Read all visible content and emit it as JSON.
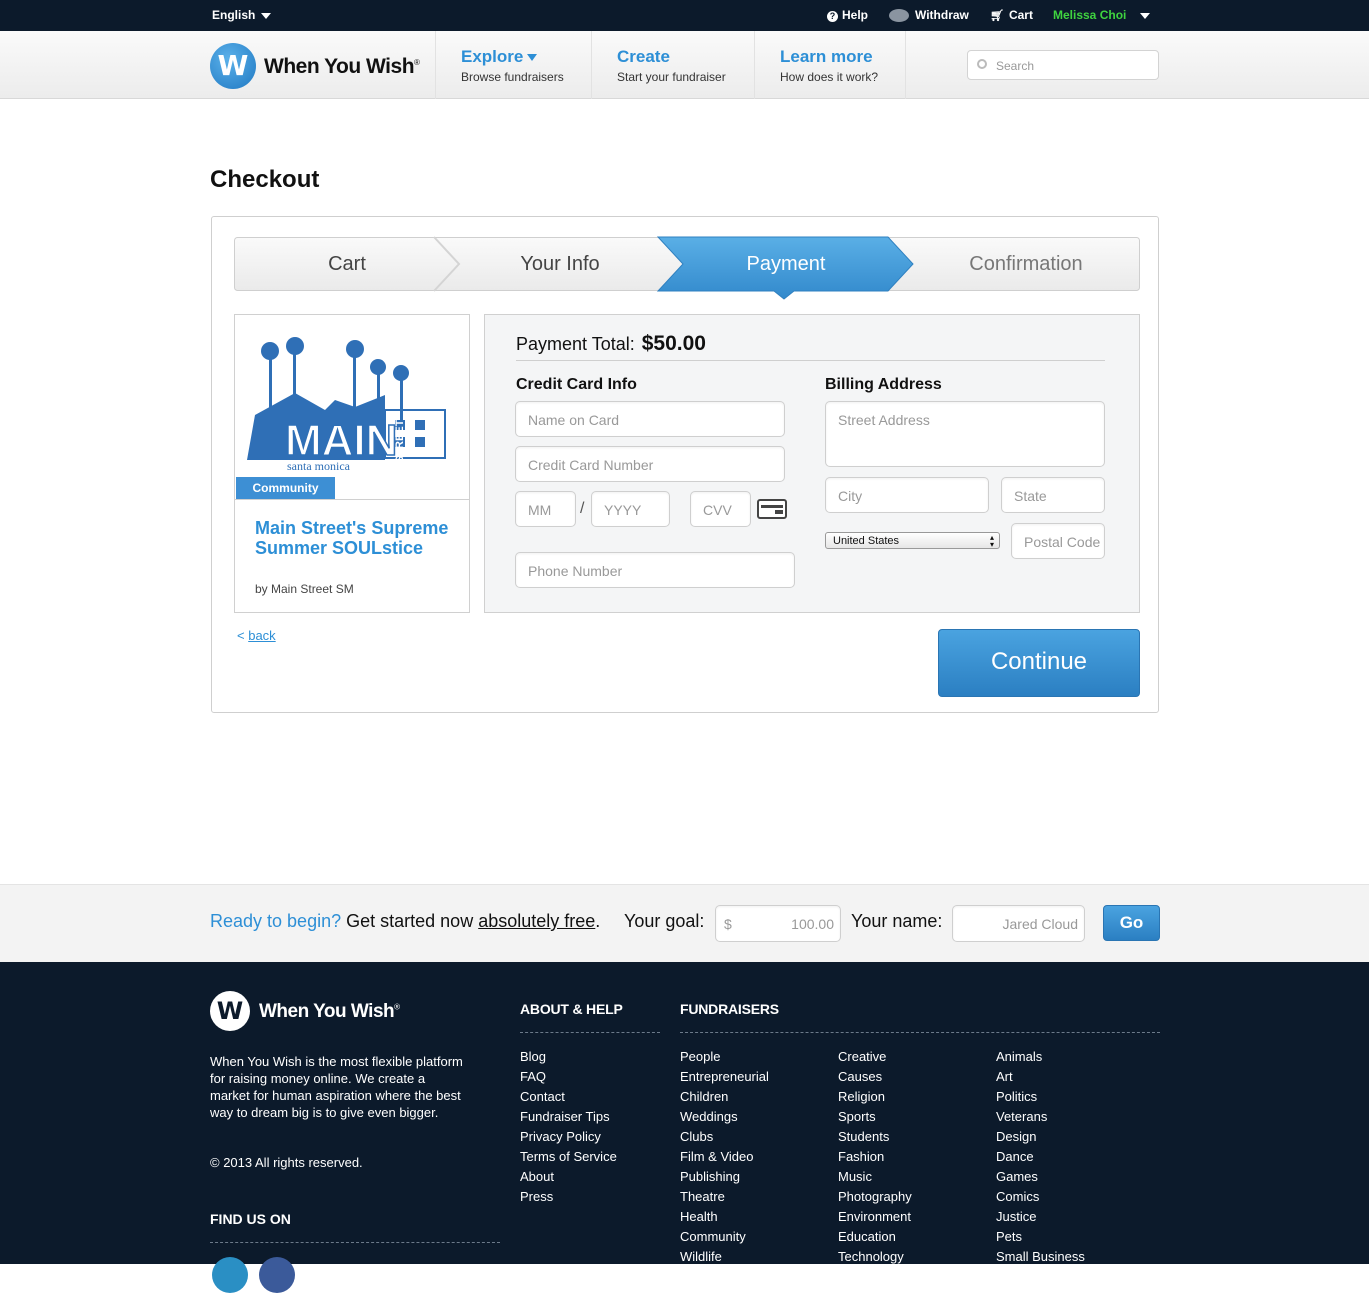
{
  "topbar": {
    "language": "English",
    "help": "Help",
    "withdraw": "Withdraw",
    "cart": "Cart",
    "user": "Melissa Choi"
  },
  "brand": {
    "name": "When You Wish",
    "logo_letter": "W",
    "accent": "#2d8fd6",
    "dark": "#0c1a2b"
  },
  "nav": [
    {
      "title": "Explore",
      "subtitle": "Browse fundraisers"
    },
    {
      "title": "Create",
      "subtitle": "Start your fundraiser"
    },
    {
      "title": "Learn more",
      "subtitle": "How does it work?"
    }
  ],
  "search": {
    "placeholder": "Search"
  },
  "checkout": {
    "title": "Checkout",
    "steps": [
      "Cart",
      "Your Info",
      "Payment",
      "Confirmation"
    ],
    "active_step": "Payment"
  },
  "product": {
    "logo_word": "MAIN",
    "logo_side": "STREET",
    "logo_sub": "santa monica",
    "category": "Community",
    "title": "Main Street's Supreme Summer SOULstice",
    "by": "by Main Street SM"
  },
  "payment": {
    "total_label": "Payment Total:",
    "total_value": "$50.00",
    "card_section": "Credit Card Info",
    "billing_section": "Billing Address",
    "name_on_card": "Name on Card",
    "card_number": "Credit Card Number",
    "mm": "MM",
    "slash": "/",
    "yyyy": "YYYY",
    "cvv": "CVV",
    "phone": "Phone Number",
    "street": "Street Address",
    "city": "City",
    "state": "State",
    "country": "United States",
    "postal": "Postal Code"
  },
  "back_label": "back",
  "back_prefix": "<",
  "continue_label": "Continue",
  "ready": {
    "lead": "Ready to begin?",
    "get_started": "Get started now",
    "free": "absolutely free",
    "period": ".",
    "goal_label": "Your goal:",
    "currency": "$",
    "goal_value": "100.00",
    "name_label": "Your name:",
    "name_value": "Jared Cloud",
    "go": "Go"
  },
  "footer": {
    "about_text": "When You Wish is the most flexible platform for raising money online. We create a market for human aspiration where the best way to dream big is to give even bigger.",
    "copyright": "© 2013 All rights reserved.",
    "find_us": "FIND US ON",
    "about_head": "ABOUT & HELP",
    "about_links": [
      "Blog",
      "FAQ",
      "Contact",
      "Fundraiser Tips",
      "Privacy Policy",
      "Terms of Service",
      "About",
      "Press"
    ],
    "fundraisers_head": "FUNDRAISERS",
    "fundraisers_col1": [
      "People",
      "Entrepreneurial",
      "Children",
      "Weddings",
      "Clubs",
      "Film & Video",
      "Publishing",
      "Theatre",
      "Health",
      "Community",
      "Wildlife"
    ],
    "fundraisers_col2": [
      "Creative",
      "Causes",
      "Religion",
      "Sports",
      "Students",
      "Fashion",
      "Music",
      "Photography",
      "Environment",
      "Education",
      "Technology"
    ],
    "fundraisers_col3": [
      "Animals",
      "Art",
      "Politics",
      "Veterans",
      "Design",
      "Dance",
      "Games",
      "Comics",
      "Justice",
      "Pets",
      "Small Business"
    ]
  }
}
